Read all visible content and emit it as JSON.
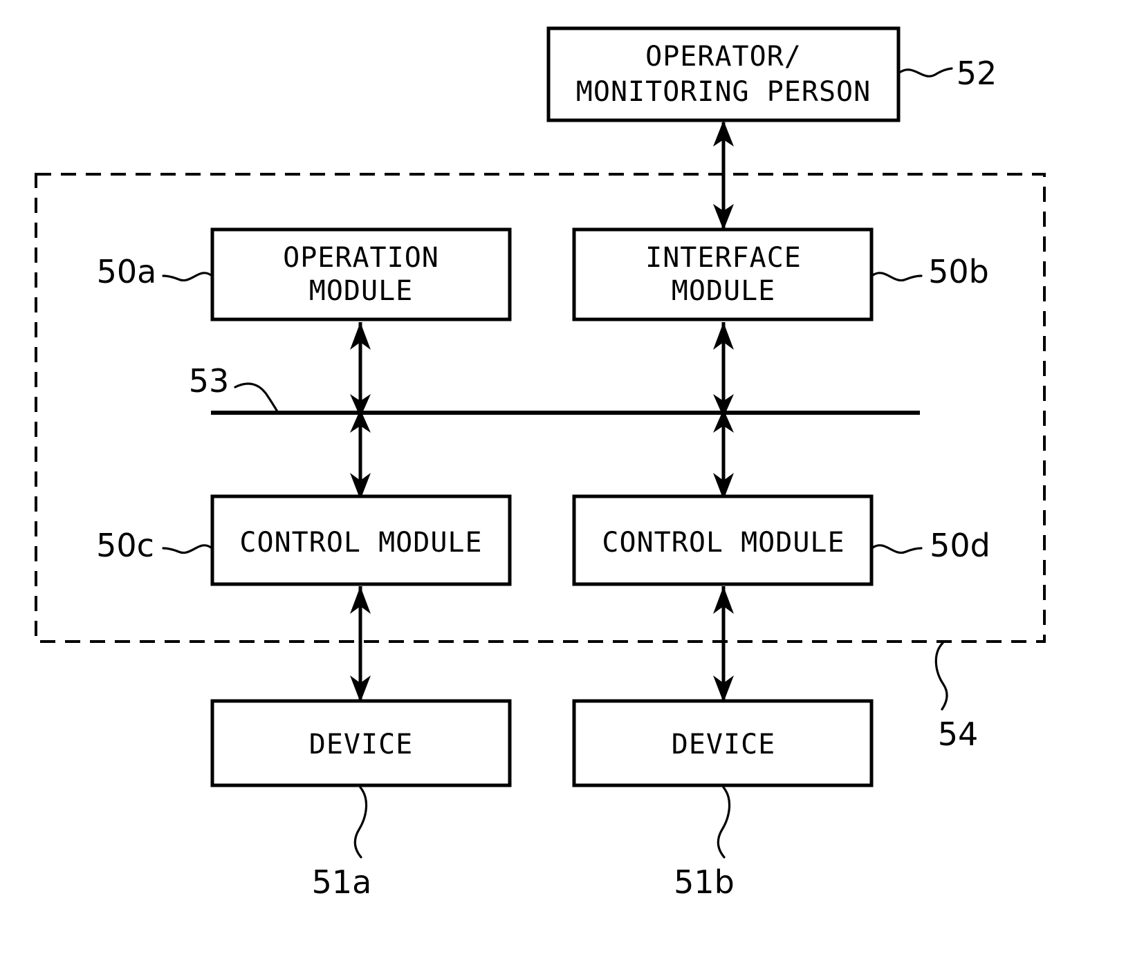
{
  "figure": {
    "type": "patent-block-diagram",
    "background_color": "#ffffff",
    "line_color": "#000000"
  },
  "boxes": {
    "operator": {
      "label_line1": "OPERATOR/",
      "label_line2": "MONITORING PERSON",
      "ref": "52"
    },
    "operation_module": {
      "label_line1": "OPERATION",
      "label_line2": "MODULE",
      "ref": "50a"
    },
    "interface_module": {
      "label_line1": "INTERFACE",
      "label_line2": "MODULE",
      "ref": "50b"
    },
    "control_module_left": {
      "label_line1": "CONTROL  MODULE",
      "ref": "50c"
    },
    "control_module_right": {
      "label_line1": "CONTROL  MODULE",
      "ref": "50d"
    },
    "device_left": {
      "label_line1": "DEVICE",
      "ref": "51a"
    },
    "device_right": {
      "label_line1": "DEVICE",
      "ref": "51b"
    }
  },
  "bus": {
    "ref": "53"
  },
  "enclosure": {
    "ref": "54"
  }
}
